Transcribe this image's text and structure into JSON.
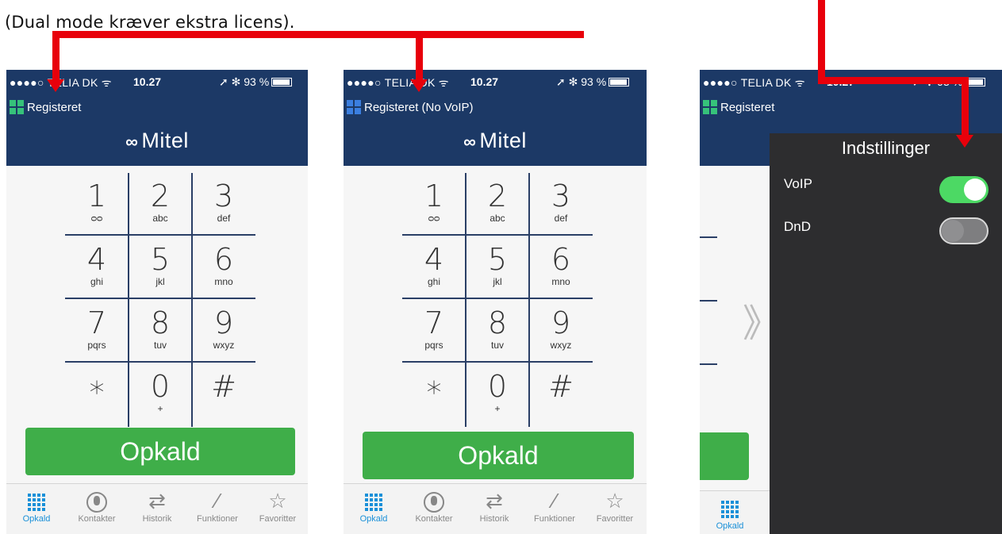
{
  "caption": "(Dual mode kræver ekstra licens).",
  "status": {
    "carrier": "●●●●○ TELIA DK ᯤ",
    "time": "10.27",
    "battery": "➚ ✻ 93 %"
  },
  "brand": {
    "logo_symbol": "∞",
    "logo_text": "Mitel"
  },
  "phones": [
    {
      "registration": "Registeret",
      "reg_colors": [
        "#36c27a",
        "#36c27a",
        "#36c27a",
        "#36c27a"
      ]
    },
    {
      "registration": "Registeret (No VoIP)",
      "reg_colors": [
        "#3b7fe0",
        "#3b7fe0",
        "#3b7fe0",
        "#3b7fe0"
      ]
    },
    {
      "registration": "Registeret",
      "reg_colors": [
        "#36c27a",
        "#36c27a",
        "#36c27a",
        "#36c27a"
      ]
    }
  ],
  "keypad": [
    {
      "digit": "1",
      "letters": "ᴑᴑ"
    },
    {
      "digit": "2",
      "letters": "abc"
    },
    {
      "digit": "3",
      "letters": "def"
    },
    {
      "digit": "4",
      "letters": "ghi"
    },
    {
      "digit": "5",
      "letters": "jkl"
    },
    {
      "digit": "6",
      "letters": "mno"
    },
    {
      "digit": "7",
      "letters": "pqrs"
    },
    {
      "digit": "8",
      "letters": "tuv"
    },
    {
      "digit": "9",
      "letters": "wxyz"
    },
    {
      "digit": "∗",
      "letters": ""
    },
    {
      "digit": "0",
      "letters": "+"
    },
    {
      "digit": "#",
      "letters": ""
    }
  ],
  "call_button": "Opkald",
  "tabs": [
    {
      "label": "Opkald",
      "icon": "dialpad-icon"
    },
    {
      "label": "Kontakter",
      "icon": "contacts-icon"
    },
    {
      "label": "Historik",
      "icon": "history-icon"
    },
    {
      "label": "Funktioner",
      "icon": "wand-icon"
    },
    {
      "label": "Favoritter",
      "icon": "star-icon"
    }
  ],
  "settings": {
    "title": "Indstillinger",
    "voip_label": "VoIP",
    "voip_on": true,
    "dnd_label": "DnD",
    "dnd_on": false
  },
  "icon_glyphs": {
    "history": "⇄",
    "wand": "⁄",
    "star": "☆",
    "left_chevron": "《",
    "right_chevron": "》"
  },
  "colors": {
    "header": "#1c3966",
    "call_button": "#3fae49",
    "active_tab": "#1a90d8",
    "arrow": "#e8000b",
    "settings_panel": "#2d2d2f",
    "toggle_on": "#4cd964"
  }
}
